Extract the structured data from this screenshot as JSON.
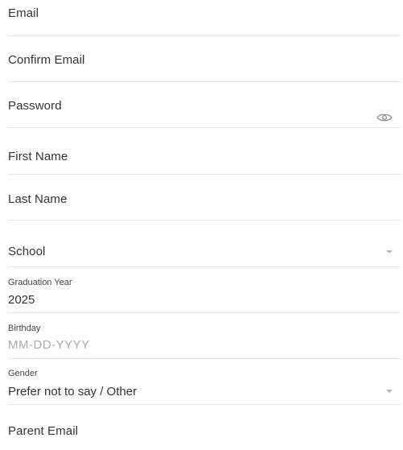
{
  "form": {
    "email": {
      "label": "Email"
    },
    "confirm_email": {
      "label": "Confirm Email"
    },
    "password": {
      "label": "Password",
      "toggle_icon": "eye-icon"
    },
    "first_name": {
      "label": "First Name"
    },
    "last_name": {
      "label": "Last Name"
    },
    "school": {
      "label": "School",
      "icon": "chevron-down-icon"
    },
    "graduation_year": {
      "label": "Graduation Year",
      "value": "2025"
    },
    "birthday": {
      "label": "Birthday",
      "placeholder": "MM-DD-YYYY"
    },
    "gender": {
      "label": "Gender",
      "value": "Prefer not to say / Other",
      "icon": "chevron-down-icon"
    },
    "parent_email": {
      "label": "Parent Email"
    }
  },
  "colors": {
    "text": "#333333",
    "divider": "#e3e3e3",
    "placeholder": "#aaaaaa",
    "icon": "#b5b5b5"
  }
}
